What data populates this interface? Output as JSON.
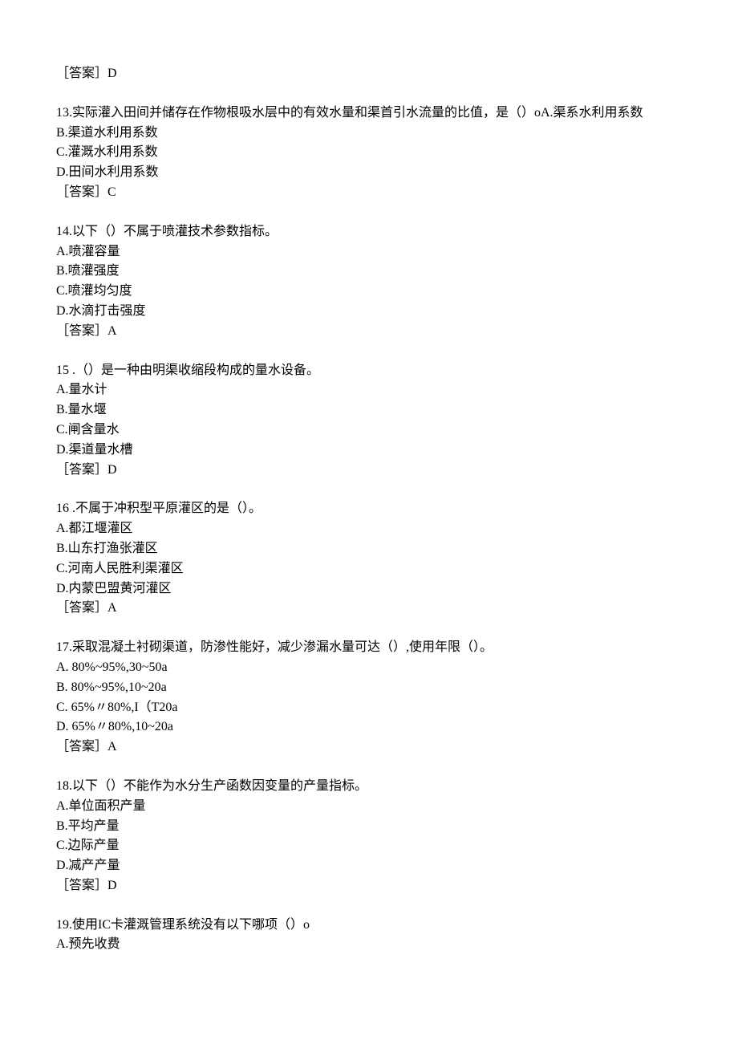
{
  "topAnswer": "［答案］D",
  "questions": [
    {
      "stem": "13.实际灌入田间并储存在作物根吸水层中的有效水量和渠首引水流量的比值，是（）oA.渠系水利用系数",
      "opts": [
        "B.渠道水利用系数",
        "C.灌溉水利用系数",
        "D.田间水利用系数"
      ],
      "ans": "［答案］C"
    },
    {
      "stem": "14.以下（）不属于喷灌技术参数指标。",
      "opts": [
        "A.喷灌容量",
        "B.喷灌强度",
        "C.喷灌均匀度",
        "D.水滴打击强度"
      ],
      "ans": "［答案］A"
    },
    {
      "stem": "15 .（）是一种由明渠收缩段构成的量水设备。",
      "opts": [
        "A.量水计",
        "B.量水堰",
        "C.闸含量水",
        "D.渠道量水槽"
      ],
      "ans": "［答案］D"
    },
    {
      "stem": "16 .不属于冲积型平原灌区的是（）。",
      "opts": [
        "A.都江堰灌区",
        "B.山东打渔张灌区",
        "C.河南人民胜利渠灌区",
        "D.内蒙巴盟黄河灌区"
      ],
      "ans": "［答案］A"
    },
    {
      "stem": "17.采取混凝土衬砌渠道，防渗性能好，减少渗漏水量可达（）,使用年限（）。",
      "opts": [
        "A.  80%~95%,30~50a",
        "B.  80%~95%,10~20a",
        "C.  65%〃80%,I（T20a",
        "D.  65%〃80%,10~20a"
      ],
      "ans": "［答案］A"
    },
    {
      "stem": "18.以下（）不能作为水分生产函数因变量的产量指标。",
      "opts": [
        "A.单位面积产量",
        "B.平均产量",
        "C.边际产量",
        "D.减产产量"
      ],
      "ans": "［答案］D"
    },
    {
      "stem": "19.使用IC卡灌溉管理系统没有以下哪项（）o",
      "opts": [
        "A.预先收费"
      ],
      "ans": ""
    }
  ]
}
